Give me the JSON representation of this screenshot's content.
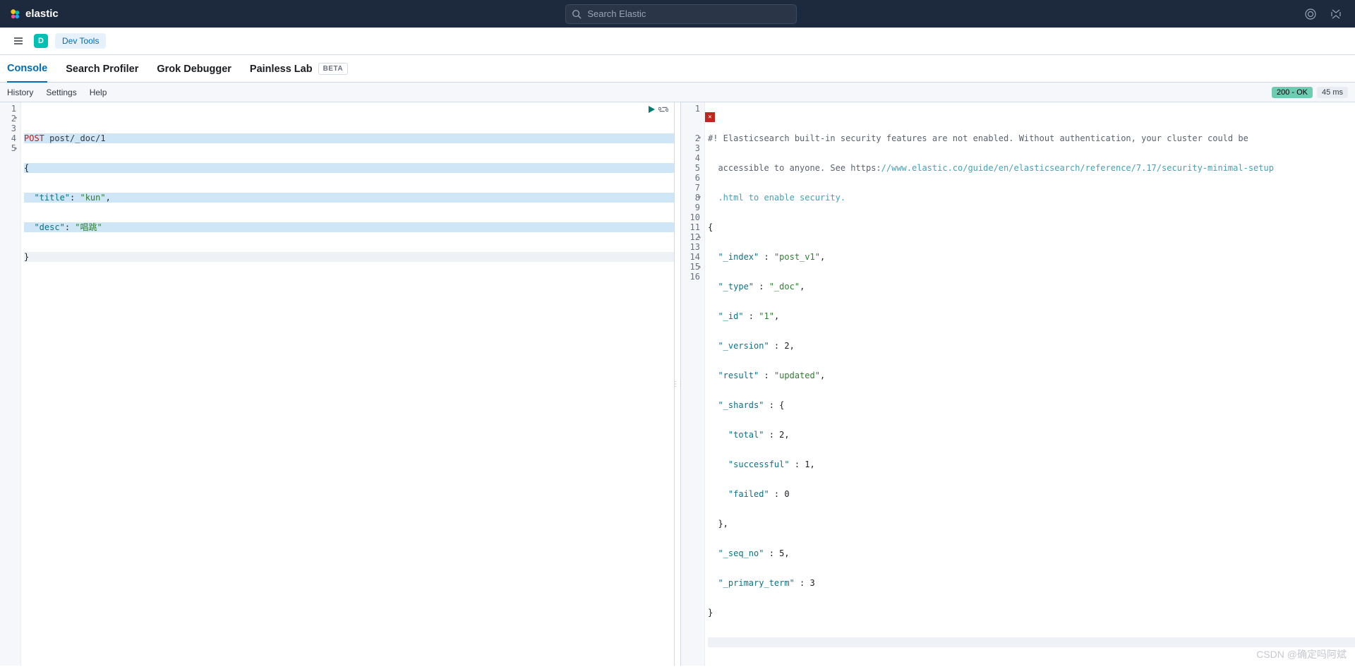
{
  "header": {
    "brand": "elastic",
    "search_placeholder": "Search Elastic",
    "space_letter": "D"
  },
  "breadcrumb": {
    "devtools": "Dev Tools"
  },
  "tabs": {
    "console": "Console",
    "profiler": "Search Profiler",
    "grok": "Grok Debugger",
    "painless": "Painless Lab",
    "beta": "BETA"
  },
  "sub": {
    "history": "History",
    "settings": "Settings",
    "help": "Help",
    "status": "200 - OK",
    "time": "45 ms"
  },
  "request": {
    "method": "POST",
    "path": " post/_doc/1",
    "title_key": "\"title\"",
    "title_val": "\"kun\"",
    "desc_key": "\"desc\"",
    "desc_val": "\"唱跳\""
  },
  "response": {
    "warn_prefix": "#! Elasticsearch built-in security features are not enabled. Without authentication, your cluster could be ",
    "warn_line2a": "accessible to anyone. See https:",
    "warn_url": "//www.elastic.co/guide/en/elasticsearch/reference/7.17/security-minimal-setup",
    "warn_line3": ".html to enable security.",
    "k_index": "\"_index\"",
    "v_index": "\"post_v1\"",
    "k_type": "\"_type\"",
    "v_type": "\"_doc\"",
    "k_id": "\"_id\"",
    "v_id": "\"1\"",
    "k_version": "\"_version\"",
    "v_version": "2",
    "k_result": "\"result\"",
    "v_result": "\"updated\"",
    "k_shards": "\"_shards\"",
    "k_total": "\"total\"",
    "v_total": "2",
    "k_successful": "\"successful\"",
    "v_successful": "1",
    "k_failed": "\"failed\"",
    "v_failed": "0",
    "k_seqno": "\"_seq_no\"",
    "v_seqno": "5",
    "k_primary": "\"_primary_term\"",
    "v_primary": "3"
  },
  "watermark": "CSDN @确定吗阿斌"
}
